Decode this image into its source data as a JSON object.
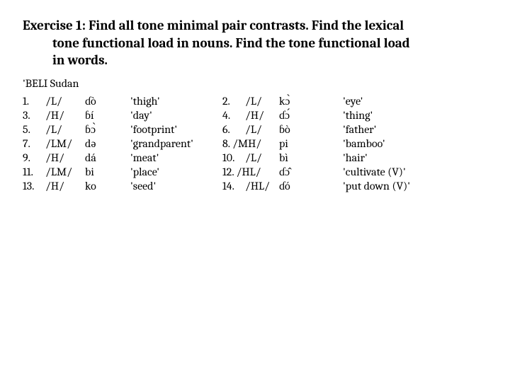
{
  "title_line1": "Exercise 1:  Find all tone minimal pair contrasts.  Find the lexical",
  "title_line2": "tone functional load in nouns.  Find the tone functional load",
  "title_line3": "in words.",
  "language_header": "'BELI Sudan",
  "rows": [
    {
      "l_num": "1.",
      "l_tone": "/L/",
      "l_word": "ɗò",
      "l_gloss": "'thigh'",
      "r_num": "2.",
      "r_tone": "/L/",
      "r_word": "kɔ̀",
      "r_gloss": "'eye'"
    },
    {
      "l_num": "3.",
      "l_tone": "/H/",
      "l_word": "ɓí",
      "l_gloss": "'day'",
      "r_num": "4.",
      "r_tone": "/H/",
      "r_word": "ɗɔ́",
      "r_gloss": "'thing'"
    },
    {
      "l_num": "5.",
      "l_tone": "/L/",
      "l_word": "ɓɔ̀",
      "l_gloss": "'footprint'",
      "r_num": "6.",
      "r_tone": "/L/",
      "r_word": "ɓò",
      "r_gloss": "'father'"
    },
    {
      "l_num": "7.",
      "l_tone": "/LM/",
      "l_word": "də",
      "l_gloss": "'grandparent'",
      "r_num": "8.",
      "r_tone": "/MH/",
      "r_word": "pi",
      "r_gloss": "'bamboo'"
    },
    {
      "l_num": "9.",
      "l_tone": "/H/",
      "l_word": "dá",
      "l_gloss": "'meat'",
      "r_num": "10.",
      "r_tone": "/L/",
      "r_word": "bì",
      "r_gloss": "'hair'"
    },
    {
      "l_num": "11.",
      "l_tone": "/LM/",
      "l_word": "bi",
      "l_gloss": "'place'",
      "r_num": "12.",
      "r_tone": "/HL/",
      "r_word": "ɗɔ̂",
      "r_gloss": "'cultivate (V)'"
    },
    {
      "l_num": "13.",
      "l_tone": "/H/",
      "l_word": "ko",
      "l_gloss": "'seed'",
      "r_num": "14.",
      "r_tone": "/HL/",
      "r_word": "ɗó",
      "r_gloss": "'put down (V)'"
    }
  ],
  "special_layout": {
    "3": {
      "gloss_before_num": true,
      "r_num_inline": true
    },
    "5": {
      "gloss_before_num": true,
      "r_num_inline": true
    }
  }
}
